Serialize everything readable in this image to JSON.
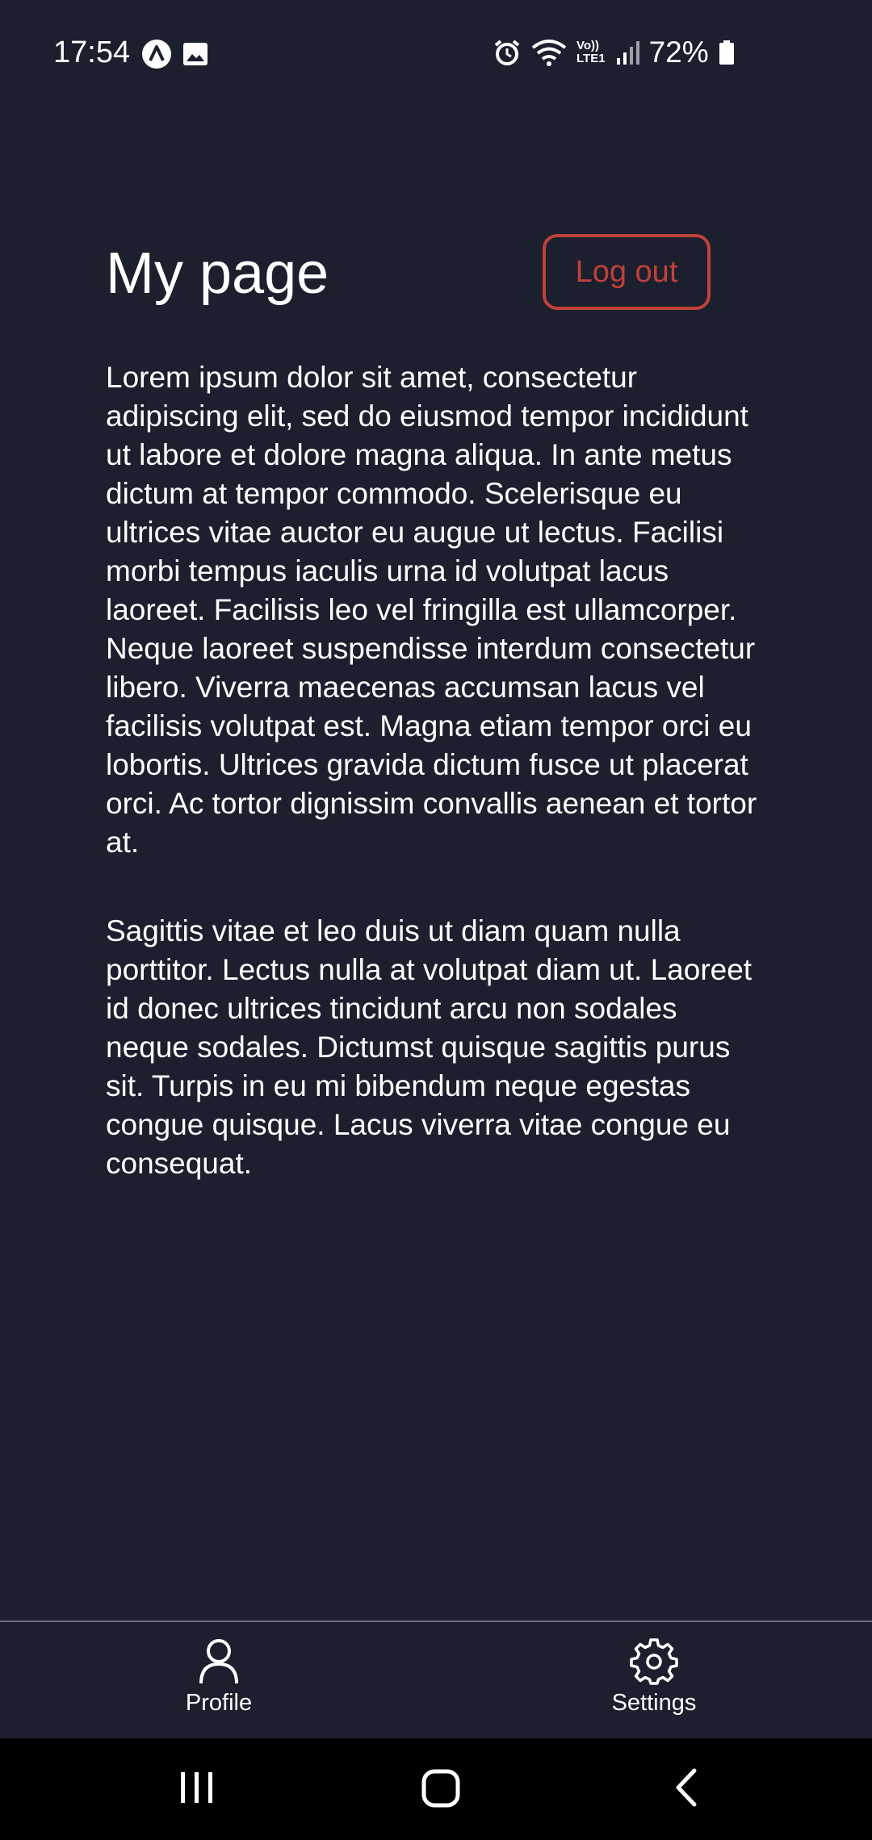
{
  "status_bar": {
    "time": "17:54",
    "battery": "72%",
    "left_icons": [
      "app-indicator-icon",
      "image-icon"
    ],
    "right_icons": [
      "alarm-icon",
      "wifi-icon",
      "volte-icon",
      "signal-icon",
      "battery-icon"
    ],
    "volte_line1": "Vo))",
    "volte_line2": "LTE1"
  },
  "header": {
    "title": "My page",
    "logout_label": "Log out"
  },
  "content": {
    "paragraphs": [
      "Lorem ipsum dolor sit amet, consectetur adipiscing elit, sed do eiusmod tempor incididunt ut labore et dolore magna aliqua. In ante metus dictum at tempor commodo. Scelerisque eu ultrices vitae auctor eu augue ut lectus. Facilisi morbi tempus iaculis urna id volutpat lacus laoreet. Facilisis leo vel fringilla est ullamcorper. Neque laoreet suspendisse interdum consectetur libero. Viverra maecenas accumsan lacus vel facilisis volutpat est. Magna etiam tempor orci eu lobortis. Ultrices gravida dictum fusce ut placerat orci. Ac tortor dignissim convallis aenean et tortor at.",
      "Sagittis vitae et leo duis ut diam quam nulla porttitor. Lectus nulla at volutpat diam ut. Laoreet id donec ultrices tincidunt arcu non sodales neque sodales. Dictumst quisque sagittis purus sit. Turpis in eu mi bibendum neque egestas congue quisque. Lacus viverra vitae congue eu consequat."
    ]
  },
  "bottom_nav": {
    "items": [
      {
        "label": "Profile",
        "icon": "person-icon"
      },
      {
        "label": "Settings",
        "icon": "gear-icon"
      }
    ]
  },
  "system_nav": {
    "buttons": [
      "recents-icon",
      "home-icon",
      "back-icon"
    ]
  },
  "colors": {
    "background": "#1c1f2e",
    "accent_red": "#c0413a",
    "text": "#ffffff",
    "divider": "#6a6d78"
  }
}
